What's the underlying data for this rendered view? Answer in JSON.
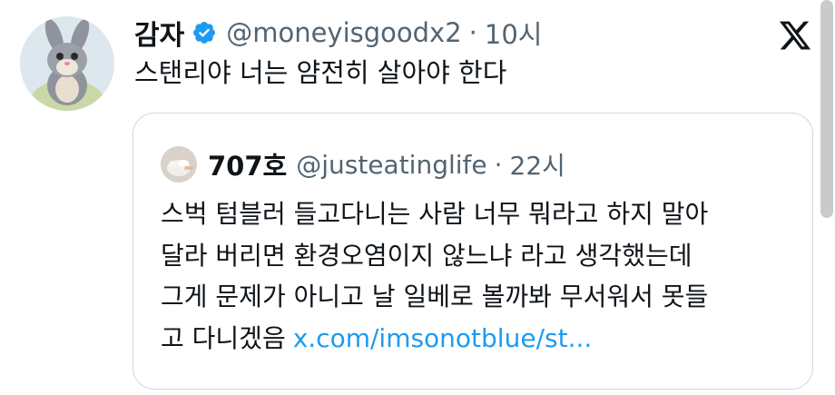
{
  "tweet": {
    "author_name": "감자",
    "handle": "@moneyisgoodx2",
    "separator": "·",
    "time": "10시",
    "text": "스탠리야 너는 얌전히 살아야 한다",
    "avatar_icon": "rabbit-avatar-icon",
    "verified_icon": "verified-badge-icon",
    "verified_color": "#1d9bf0"
  },
  "quote": {
    "author_name": "707호",
    "handle": "@justeatinglife",
    "separator": "·",
    "time": "22시",
    "lines": [
      "스벅 텀블러 들고다니는 사람 너무 뭐라고 하지 말아",
      "달라 버리면 환경오염이지 않느냐 라고 생각했는데",
      "그게 문제가 아니고 날 일베로 볼까봐 무서워서 못들",
      "고 다니겠음"
    ],
    "link": "x.com/imsonotblue/st...",
    "link_color": "#1d9bf0"
  },
  "brand": {
    "logo_icon": "x-logo-icon"
  }
}
